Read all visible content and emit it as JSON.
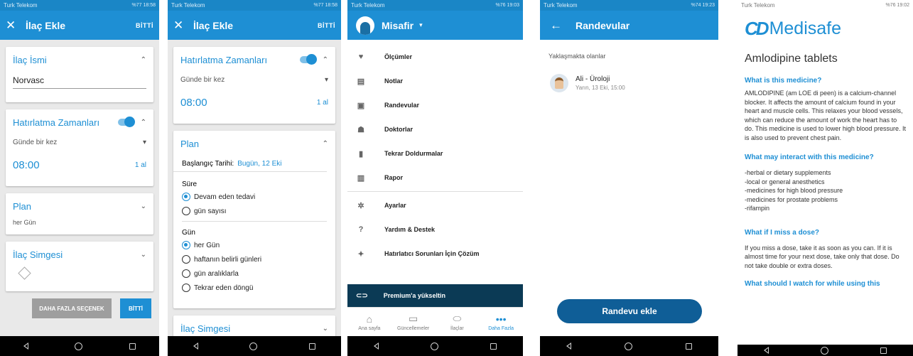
{
  "screens": {
    "add_med": {
      "status_carrier": "Turk Telekom",
      "status_right": "%77 18:58",
      "title": "İlaç Ekle",
      "done": "BİTTİ",
      "med_name_label": "İlaç İsmi",
      "med_name_value": "Norvasc",
      "reminders_label": "Hatırlatma Zamanları",
      "frequency": "Günde bir kez",
      "time": "08:00",
      "dose": "1 al",
      "plan_label": "Plan",
      "plan_value": "her Gün",
      "icon_label": "İlaç Simgesi",
      "more_options": "DAHA FAZLA SEÇENEK",
      "done_button": "BİTTİ"
    },
    "plan": {
      "status_carrier": "Turk Telekom",
      "status_right": "%77 18:58",
      "title": "İlaç Ekle",
      "done": "BİTTİ",
      "reminders_label": "Hatırlatma Zamanları",
      "frequency": "Günde bir kez",
      "time": "08:00",
      "dose": "1 al",
      "plan_label": "Plan",
      "start_label": "Başlangıç Tarihi:",
      "start_value": "Bugün, 12 Eki",
      "duration_label": "Süre",
      "duration_options": [
        "Devam eden tedavi",
        "gün sayısı"
      ],
      "day_label": "Gün",
      "day_options": [
        "her Gün",
        "haftanın belirli günleri",
        "gün aralıklarla",
        "Tekrar eden döngü"
      ],
      "icon_label": "İlaç Simgesi"
    },
    "menu": {
      "status_carrier": "Turk Telekom",
      "status_right": "%76 19:03",
      "user": "Misafir",
      "items": [
        "Ölçümler",
        "Notlar",
        "Randevular",
        "Doktorlar",
        "Tekrar Doldurmalar",
        "Rapor"
      ],
      "items2": [
        "Ayarlar",
        "Yardım & Destek",
        "Hatırlatıcı Sorunları İçin Çözüm"
      ],
      "premium": "Premium'a yükseltin",
      "tabs": [
        "Ana sayfa",
        "Güncellemeler",
        "İlaçlar",
        "Daha Fazla"
      ]
    },
    "appointments": {
      "status_carrier": "Turk Telekom",
      "status_right": "%74 19:23",
      "title": "Randevular",
      "section": "Yaklaşmakta olanlar",
      "appt_title": "Ali - Üroloji",
      "appt_time": "Yarın, 13 Eki, 15:00",
      "add_button": "Randevu ekle"
    },
    "medisafe": {
      "status_carrier": "Turk Telekom",
      "status_right": "%76 19:02",
      "logo": "Medisafe",
      "drug": "Amlodipine tablets",
      "h1": "What is this medicine?",
      "p1": "AMLODIPINE (am LOE di peen) is a calcium-channel blocker. It affects the amount of calcium found in your heart and muscle cells. This relaxes your blood vessels, which can reduce the amount of work the heart has to do. This medicine is used to lower high blood pressure. It is also used to prevent chest pain.",
      "h2": "What may interact with this medicine?",
      "interactions": [
        "-herbal or dietary supplements",
        "-local or general anesthetics",
        "-medicines for high blood pressure",
        "-medicines for prostate problems",
        "-rifampin"
      ],
      "h3": "What if I miss a dose?",
      "p3": "If you miss a dose, take it as soon as you can. If it is almost time for your next dose, take only that dose. Do not take double or extra doses.",
      "h4": "What should I watch for while using this"
    }
  },
  "colors": {
    "primary": "#1e8fd4",
    "status": "#1a86c6",
    "premium_bar": "#0b3a55",
    "button_gray": "#9e9e9e"
  }
}
